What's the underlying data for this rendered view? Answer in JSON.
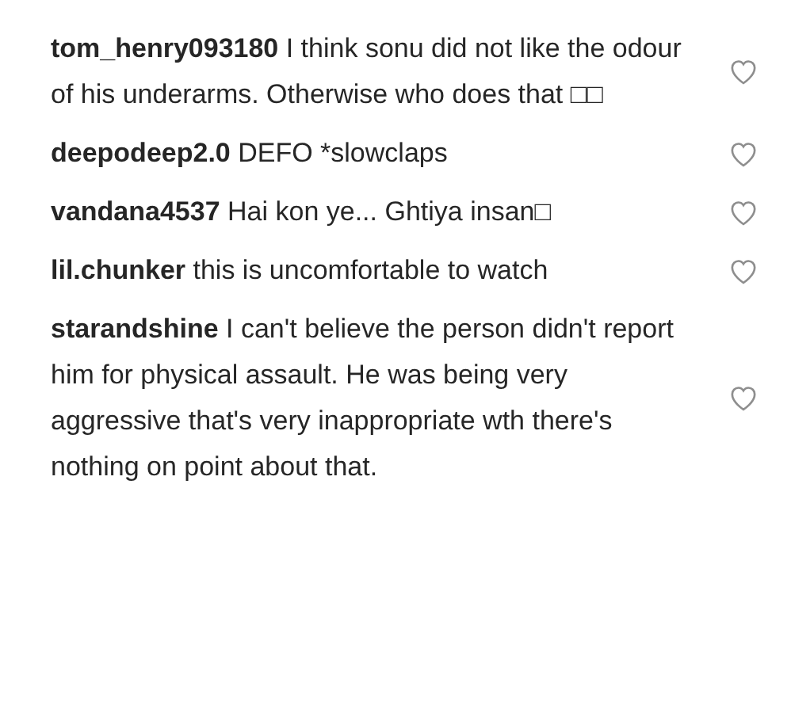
{
  "comments": [
    {
      "username": "tom_henry093180",
      "text": "I think sonu did not like the odour of his underarms. Otherwise who does that □□",
      "liked": false
    },
    {
      "username": "deepodeep2.0",
      "text": "DEFO *slowclaps",
      "liked": false
    },
    {
      "username": "vandana4537",
      "text": "Hai kon ye... Ghtiya insan□",
      "liked": false
    },
    {
      "username": "lil.chunker",
      "text": "this is uncomfortable to watch",
      "liked": false
    },
    {
      "username": "starandshine",
      "text": "I can't believe the person didn't report him for physical assault. He was being very aggressive that's very inappropriate wth there's nothing on point about that.",
      "liked": false
    }
  ]
}
